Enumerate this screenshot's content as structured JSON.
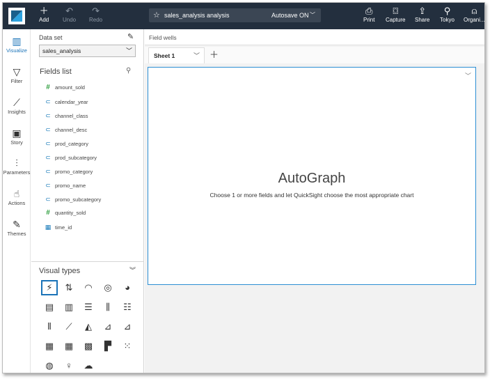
{
  "topbar": {
    "add": "Add",
    "undo": "Undo",
    "redo": "Redo",
    "analysis_name": "sales_analysis analysis",
    "autosave": "Autosave ON",
    "print": "Print",
    "capture": "Capture",
    "share": "Share",
    "region": "Tokyo",
    "org": "Organi..."
  },
  "rail": [
    "Visualize",
    "Filter",
    "Insights",
    "Story",
    "Parameters",
    "Actions",
    "Themes"
  ],
  "panel": {
    "dataset_label": "Data set",
    "dataset_value": "sales_analysis",
    "fields_title": "Fields list",
    "fields": [
      {
        "name": "amount_sold",
        "type": "measure"
      },
      {
        "name": "calendar_year",
        "type": "dim"
      },
      {
        "name": "channel_class",
        "type": "dim"
      },
      {
        "name": "channel_desc",
        "type": "dim"
      },
      {
        "name": "prod_category",
        "type": "dim"
      },
      {
        "name": "prod_subcategory",
        "type": "dim"
      },
      {
        "name": "promo_category",
        "type": "dim"
      },
      {
        "name": "promo_name",
        "type": "dim"
      },
      {
        "name": "promo_subcategory",
        "type": "dim"
      },
      {
        "name": "quantity_sold",
        "type": "measure"
      },
      {
        "name": "time_id",
        "type": "date"
      }
    ],
    "visual_types_title": "Visual types"
  },
  "main": {
    "field_wells": "Field wells",
    "sheet_tab": "Sheet 1",
    "autograph_title": "AutoGraph",
    "autograph_sub": "Choose 1 or more fields and let QuickSight choose the most appropriate chart"
  },
  "colors": {
    "topbar": "#232f3e",
    "accent": "#1a73b8",
    "measure": "#2e9e3e"
  }
}
